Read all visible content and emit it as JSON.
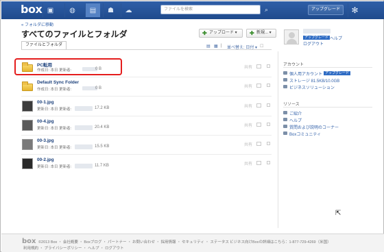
{
  "topbar": {
    "logo": "box",
    "search_placeholder": "ファイルを検索",
    "upgrade_label": "アップグレード",
    "nav_icons": [
      "dashboard-icon",
      "globe-icon",
      "folder-icon",
      "people-icon",
      "cloud-icon"
    ],
    "accent": "#1f4a8c"
  },
  "header": {
    "back_link": "« フォルダに移動",
    "title": "すべてのファイルとフォルダ",
    "upload_label": "アップロード ▾",
    "new_label": "新規... ▾",
    "tab_label": "ファイルとフォルダ",
    "sort_label": "並べ替え: 日付 ▾"
  },
  "profile": {
    "badge": "アップグレード",
    "help": "ヘルプ",
    "logout": "ログアウト"
  },
  "files": [
    {
      "name": "PC転用",
      "meta": "作成日: 本日 更新者:",
      "size": "0 B",
      "type": "folder",
      "thumb": ""
    },
    {
      "name": "Default Sync Folder",
      "meta": "作成日: 本日 更新者:",
      "size": "0 B",
      "type": "folder",
      "thumb": ""
    },
    {
      "name": "00-1.jpg",
      "meta": "更新日: 本日 更新者:",
      "size": "17.2 KB",
      "type": "image",
      "thumb": "#3c3c3c"
    },
    {
      "name": "00-4.jpg",
      "meta": "更新日: 本日 更新者:",
      "size": "20.4 KB",
      "type": "image",
      "thumb": "#5a5a5a"
    },
    {
      "name": "00-3.jpg",
      "meta": "更新日: 本日 更新者:",
      "size": "15.5 KB",
      "type": "image",
      "thumb": "#7a7a7a"
    },
    {
      "name": "00-2.jpg",
      "meta": "更新日: 本日 更新者:",
      "size": "11.7 KB",
      "type": "image",
      "thumb": "#2a2a2a"
    }
  ],
  "row_actions": {
    "share": "共有"
  },
  "sidebar": {
    "account_head": "アカウント",
    "account_items": [
      "個人用アカウント",
      "ストレージ 81.5KB/10.0GB",
      "ビジネスソリューション"
    ],
    "account_badge": "アップグレード",
    "resources_head": "リソース",
    "resource_items": [
      "ご紹介",
      "ヘルプ",
      "質問および説明のコーナー",
      "Boxコミュニティ"
    ]
  },
  "footer": {
    "logo": "box",
    "line1": "©2013 Box ・ 会社概要 ・ Boxブログ ・ パートナー ・ お問い合わせ ・ 採用情報 ・ セキュリティ ・ ステータス",
    "line2": "利用規約 ・ プライバシーポリシー ・ ヘルプ ・ ログアウト",
    "right": "ビジネス向けBoxの詳細はこちら：1-877-729-4269（米国）"
  }
}
